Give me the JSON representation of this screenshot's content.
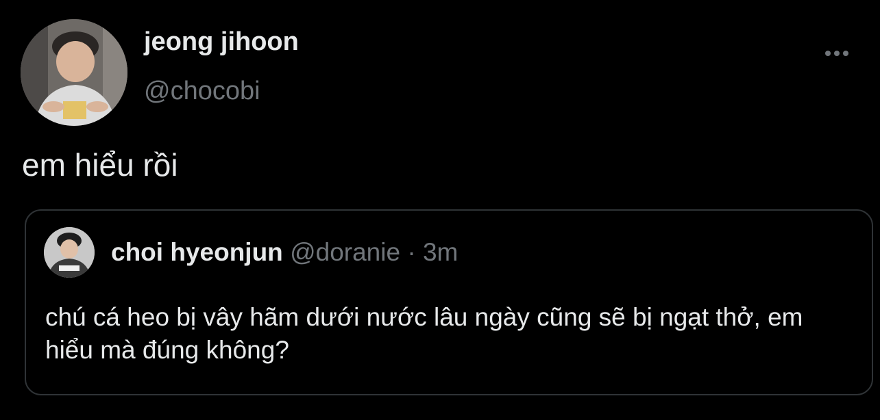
{
  "tweet": {
    "author": {
      "display_name": "jeong jihoon",
      "handle": "@chocobi",
      "avatar_icon": "profile-photo"
    },
    "text": "em hiểu rồi",
    "more_icon": "more-horizontal-icon"
  },
  "quoted_tweet": {
    "author": {
      "display_name": "choi hyeonjun",
      "handle": "@doranie",
      "avatar_icon": "profile-photo"
    },
    "separator": "·",
    "time": "3m",
    "text": "chú cá heo bị vây hãm dưới nước lâu ngày cũng sẽ bị ngạt thở, em hiểu mà đúng không?"
  },
  "colors": {
    "background": "#000000",
    "primary_text": "#e7e9ea",
    "secondary_text": "#71767b",
    "border": "#2f3336"
  }
}
